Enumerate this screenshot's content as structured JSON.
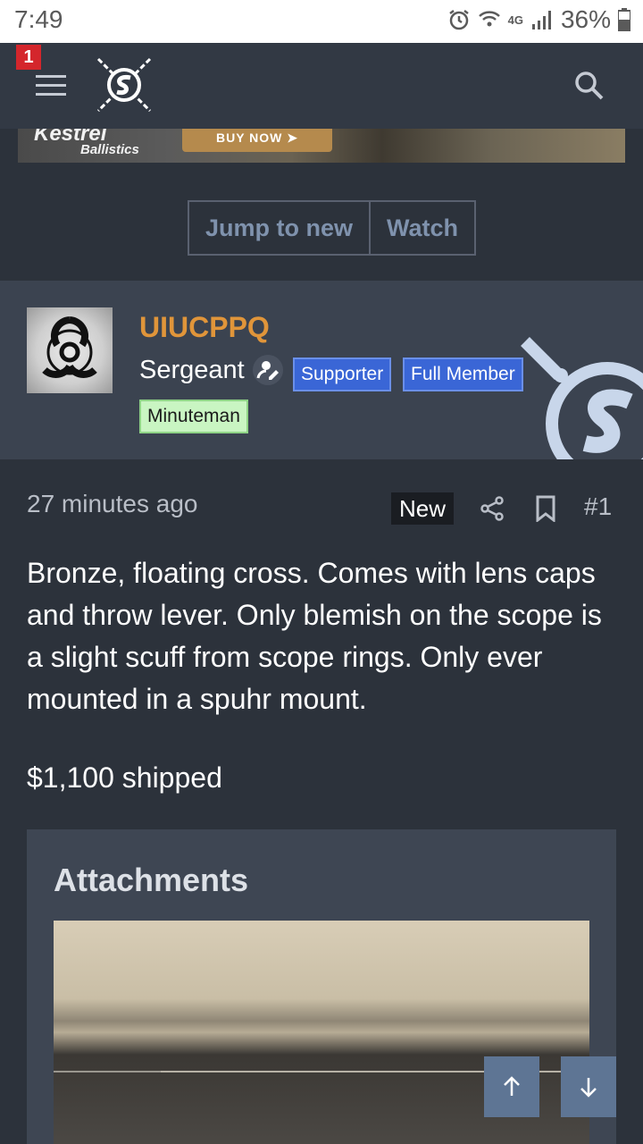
{
  "status_bar": {
    "time": "7:49",
    "network": "4G",
    "battery": "36%"
  },
  "header": {
    "notification_count": "1",
    "logo_icon": "snipers-hide-logo",
    "search_icon": "search-icon",
    "menu_icon": "hamburger-menu-icon"
  },
  "ad_banner": {
    "brand_line1": "Kestrel",
    "brand_line2": "Ballistics",
    "button_label": "BUY NOW ➤"
  },
  "thread_actions": {
    "jump_label": "Jump to new",
    "watch_label": "Watch"
  },
  "post": {
    "username": "UIUCPPQ",
    "rank": "Sergeant",
    "badges": [
      "Supporter",
      "Full Member"
    ],
    "extra_badge": "Minuteman",
    "time": "27 minutes ago",
    "new_label": "New",
    "post_number": "#1",
    "body": "Bronze, floating cross. Comes with lens caps and throw lever. Only blemish on the scope is a slight scuff from scope rings. Only ever mounted in a spuhr mount.",
    "price": "$1,100 shipped"
  },
  "attachments": {
    "title": "Attachments"
  },
  "colors": {
    "background": "#2c323b",
    "header": "#323944",
    "username": "#e0953a",
    "badge_blue": "#3a66d6",
    "badge_green": "#c9f5c2",
    "link": "#7f92ad"
  }
}
